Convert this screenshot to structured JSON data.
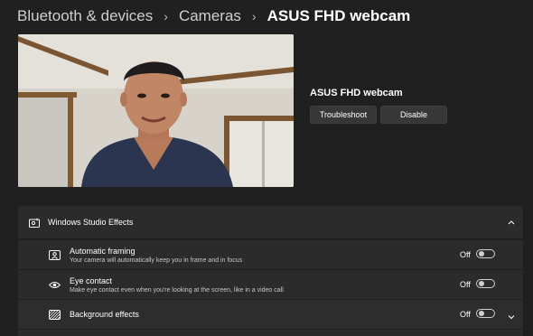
{
  "breadcrumb": {
    "items": [
      "Bluetooth & devices",
      "Cameras",
      "ASUS FHD webcam"
    ]
  },
  "device": {
    "name": "ASUS FHD webcam",
    "troubleshoot_label": "Troubleshoot",
    "disable_label": "Disable"
  },
  "studio_effects": {
    "title": "Windows Studio Effects",
    "items": [
      {
        "title": "Automatic framing",
        "description": "Your camera will automatically keep you in frame and in focus",
        "state": "Off"
      },
      {
        "title": "Eye contact",
        "description": "Make eye contact even when you're looking at the screen, like in a video call",
        "state": "Off"
      },
      {
        "title": "Background effects",
        "state": "Off"
      }
    ]
  },
  "icons": [
    "chevron-right-icon",
    "studio-effects-icon",
    "chevron-up-icon",
    "framing-icon",
    "eye-icon",
    "background-effects-icon",
    "chevron-down-icon"
  ]
}
